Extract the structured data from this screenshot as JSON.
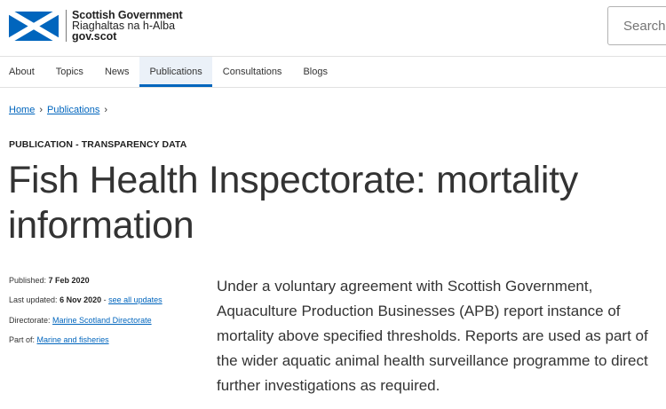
{
  "header": {
    "logo": {
      "line1": "Scottish Government",
      "line2": "Riaghaltas na h-Alba",
      "line3": "gov.scot",
      "flag_blue": "#0065bd",
      "flag_white": "#ffffff"
    },
    "search": {
      "placeholder": "Search",
      "value": ""
    }
  },
  "nav": {
    "items": [
      {
        "label": "About"
      },
      {
        "label": "Topics"
      },
      {
        "label": "News"
      },
      {
        "label": "Publications"
      },
      {
        "label": "Consultations"
      },
      {
        "label": "Blogs"
      }
    ],
    "active_index": 3,
    "active_color": "#0065bd"
  },
  "breadcrumb": {
    "items": [
      {
        "label": "Home"
      },
      {
        "label": "Publications"
      }
    ],
    "separator_icon": "chevron-right-icon",
    "separator": "›"
  },
  "document": {
    "type_label": "PUBLICATION - TRANSPARENCY DATA",
    "title": "Fish Health Inspectorate: mortality information",
    "meta": {
      "published_label": "Published:",
      "published_value": "7 Feb 2020",
      "updated_label": "Last updated:",
      "updated_value": "6 Nov 2020",
      "updated_sep": " - ",
      "see_all_updates": "see all updates",
      "directorate_label": "Directorate:",
      "directorate_value": "Marine Scotland Directorate",
      "part_of_label": "Part of:",
      "part_of_value": "Marine and fisheries"
    },
    "summary": "Under a voluntary agreement with Scottish Government, Aquaculture Production Businesses (APB) report instance of mortality above specified thresholds. Reports are used as part of the wider aquatic animal health surveillance programme to direct further investigations as required."
  },
  "colors": {
    "link": "#0065bd",
    "text": "#333333",
    "nav_active_bg": "#ebf1f8"
  }
}
